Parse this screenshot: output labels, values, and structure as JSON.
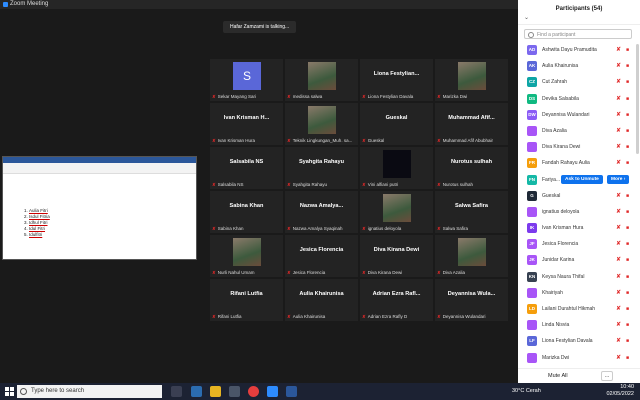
{
  "window": {
    "title": "Zoom Meeting"
  },
  "talking_banner": "Hafar Zamzami is talking...",
  "tiles": [
    {
      "name": "",
      "footer": "Sekar Mayang Sari",
      "photo": "avatar-s",
      "avatar_letter": "S"
    },
    {
      "name": "",
      "footer": "medissa salwa",
      "photo": "photo"
    },
    {
      "name": "Liona  Festylian...",
      "footer": "Liona Festylian Davala"
    },
    {
      "name": "",
      "footer": "Marizka Dwi",
      "photo": "photo"
    },
    {
      "name": "Ivan Krisman H...",
      "footer": "Ivan Krisman Hura"
    },
    {
      "name": "",
      "footer": "Teknik Lingkungan_Muh. sa...",
      "photo": "photo"
    },
    {
      "name": "Gueskal",
      "footer": "Gueskal"
    },
    {
      "name": "Muhammad  Afif...",
      "footer": "Muhammad Afif Abubhair"
    },
    {
      "name": "Salsabila NS",
      "footer": "Salsabila NS"
    },
    {
      "name": "Syahgita Rahayu",
      "footer": "Syahgita Rahayu"
    },
    {
      "name": "",
      "footer": "Vini alfiani putri",
      "photo": "dark"
    },
    {
      "name": "Nurotus sulhah",
      "footer": "Nurotus sulhah"
    },
    {
      "name": "Sabina Khan",
      "footer": "Sabina Khan"
    },
    {
      "name": "Nazwa  Amalya...",
      "footer": "Nazwa Amalya Syaqinah"
    },
    {
      "name": "",
      "footer": "ignatius deloyola",
      "photo": "photo"
    },
    {
      "name": "Salwa Safira",
      "footer": "Salwa Safira"
    },
    {
      "name": "",
      "footer": "Nurli Nahul Umam",
      "photo": "photo"
    },
    {
      "name": "Jesica Florencia",
      "footer": "Jesica Florencia"
    },
    {
      "name": "Diva Kirana Dewi",
      "footer": "Diva Kirana Dewi"
    },
    {
      "name": "",
      "footer": "Diva Azalia",
      "photo": "photo"
    },
    {
      "name": "Rifani Lutfia",
      "footer": "Rifani Lutfia"
    },
    {
      "name": "Aulia Khairunisa",
      "footer": "Aulia Khairunisa"
    },
    {
      "name": "Adrian  Ezra  Rafl...",
      "footer": "Adrian Ezra Rafly D"
    },
    {
      "name": "Deyannisa  Wula...",
      "footer": "Deyannisa Wulandari"
    }
  ],
  "shared_doc": {
    "list": [
      "Aulia Fitri",
      "Isdul Fitria",
      "Idhul Fitri",
      "Idul Fitri",
      "Idulfitri"
    ]
  },
  "participants": {
    "title": "Participants (54)",
    "search_placeholder": "Find a participant",
    "list": [
      {
        "initials": "AD",
        "name": "Ashwita Dayu Pramudita",
        "color": "#7b68ee"
      },
      {
        "initials": "AK",
        "name": "Aulia Khairunisa",
        "color": "#5a67d8"
      },
      {
        "initials": "CZ",
        "name": "Cut Zahrah",
        "color": "#0ea5a5"
      },
      {
        "initials": "DS",
        "name": "Devika Salsabila",
        "color": "#10b981"
      },
      {
        "initials": "DW",
        "name": "Deyannisa Wulandari",
        "color": "#8b5cf6"
      },
      {
        "initials": "",
        "name": "Diva Azalia",
        "color": "#a855f7"
      },
      {
        "initials": "",
        "name": "Diva Kirana Dewi",
        "color": "#a855f7"
      },
      {
        "initials": "FR",
        "name": "Fandah Rahayu Aulia",
        "color": "#f59e0b"
      },
      {
        "initials": "FN",
        "name": "Fariya...",
        "color": "#14b8a6",
        "ask_unmute": "Ask to Unmute",
        "more": "More ›"
      },
      {
        "initials": "G",
        "name": "Gueskal",
        "color": "#1f2937"
      },
      {
        "initials": "",
        "name": "ignatius deloyola",
        "color": "#a855f7"
      },
      {
        "initials": "IK",
        "name": "Ivan Krisman Hura",
        "color": "#7c3aed"
      },
      {
        "initials": "JF",
        "name": "Jesica Florencia",
        "color": "#a855f7"
      },
      {
        "initials": "JK",
        "name": "Junidar Karina",
        "color": "#a855f7"
      },
      {
        "initials": "KN",
        "name": "Keysa Naura Thifal",
        "color": "#374151"
      },
      {
        "initials": "",
        "name": "Khairiyah",
        "color": "#a855f7"
      },
      {
        "initials": "LD",
        "name": "Lailani Durahtul Hikmah",
        "color": "#f59e0b"
      },
      {
        "initials": "",
        "name": "Linda Nisvia",
        "color": "#a855f7"
      },
      {
        "initials": "LF",
        "name": "Liona Festylian Davala",
        "color": "#5a67d8"
      },
      {
        "initials": "",
        "name": "Marizka Dwi",
        "color": "#a855f7"
      }
    ],
    "mute_all": "Mute All",
    "more_dots": "..."
  },
  "taskbar": {
    "search_placeholder": "Type here to search",
    "weather": "30°C  Cerah",
    "time": "10:40",
    "date": "02/05/2022"
  }
}
